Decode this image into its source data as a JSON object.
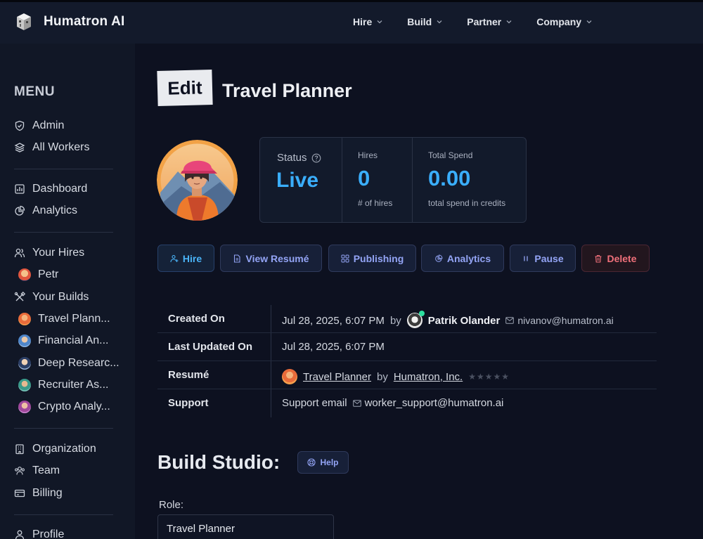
{
  "app": {
    "brand": "Humatron AI"
  },
  "topnav": [
    {
      "label": "Hire"
    },
    {
      "label": "Build"
    },
    {
      "label": "Partner"
    },
    {
      "label": "Company"
    }
  ],
  "sidebar": {
    "menu_title": "MENU",
    "items": {
      "admin": "Admin",
      "all_workers": "All Workers",
      "dashboard": "Dashboard",
      "analytics": "Analytics",
      "your_hires": "Your Hires",
      "petr": "Petr",
      "your_builds": "Your Builds",
      "travel": "Travel Plann...",
      "financial": "Financial An...",
      "deep": "Deep Researc...",
      "recruiter": "Recruiter As...",
      "crypto": "Crypto Analy...",
      "organization": "Organization",
      "team": "Team",
      "billing": "Billing",
      "profile": "Profile"
    }
  },
  "page": {
    "edit_badge": "Edit",
    "title": "Travel Planner"
  },
  "stats": {
    "status_label": "Status",
    "status_value": "Live",
    "hires_label": "Hires",
    "hires_value": "0",
    "hires_caption": "# of hires",
    "spend_label": "Total Spend",
    "spend_value": "0.00",
    "spend_caption": "total spend in credits"
  },
  "actions": {
    "hire": "Hire",
    "view_resume": "View Resumé",
    "publishing": "Publishing",
    "analytics": "Analytics",
    "pause": "Pause",
    "delete": "Delete"
  },
  "info": {
    "created_on_label": "Created On",
    "created_on_value": "Jul 28, 2025, 6:07 PM",
    "by": "by",
    "creator_name": "Patrik Olander",
    "creator_email": "nivanov@humatron.ai",
    "updated_label": "Last Updated On",
    "updated_value": "Jul 28, 2025, 6:07 PM",
    "resume_label": "Resumé",
    "resume_link": "Travel Planner",
    "resume_by": "by",
    "resume_company": "Humatron, Inc.",
    "rating_stars": "★★★★★",
    "support_label": "Support",
    "support_text": "Support email",
    "support_email": "worker_support@humatron.ai"
  },
  "build": {
    "title": "Build Studio:",
    "help": "Help",
    "role_label": "Role:",
    "role_value": "Travel Planner"
  },
  "colors": {
    "accent_blue": "#3aaefc",
    "button_text": "#93a4f5",
    "delete_red": "#f0707a",
    "background": "#0d1120"
  }
}
